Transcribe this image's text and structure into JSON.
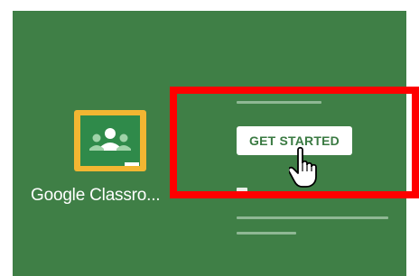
{
  "app": {
    "brand_label": "Google Classroom",
    "brand_visible_label": "Google Classro..."
  },
  "hero": {
    "cta_label": "GET STARTED"
  },
  "icons": {
    "logo": "google-classroom-logo-icon",
    "cursor": "hand-pointer-cursor-icon"
  },
  "colors": {
    "panel_bg": "#3f7f46",
    "logo_tile": "#f2b632",
    "logo_board": "#2f8a4a",
    "cta_text": "#3a7a42",
    "highlight": "#ff0000"
  }
}
